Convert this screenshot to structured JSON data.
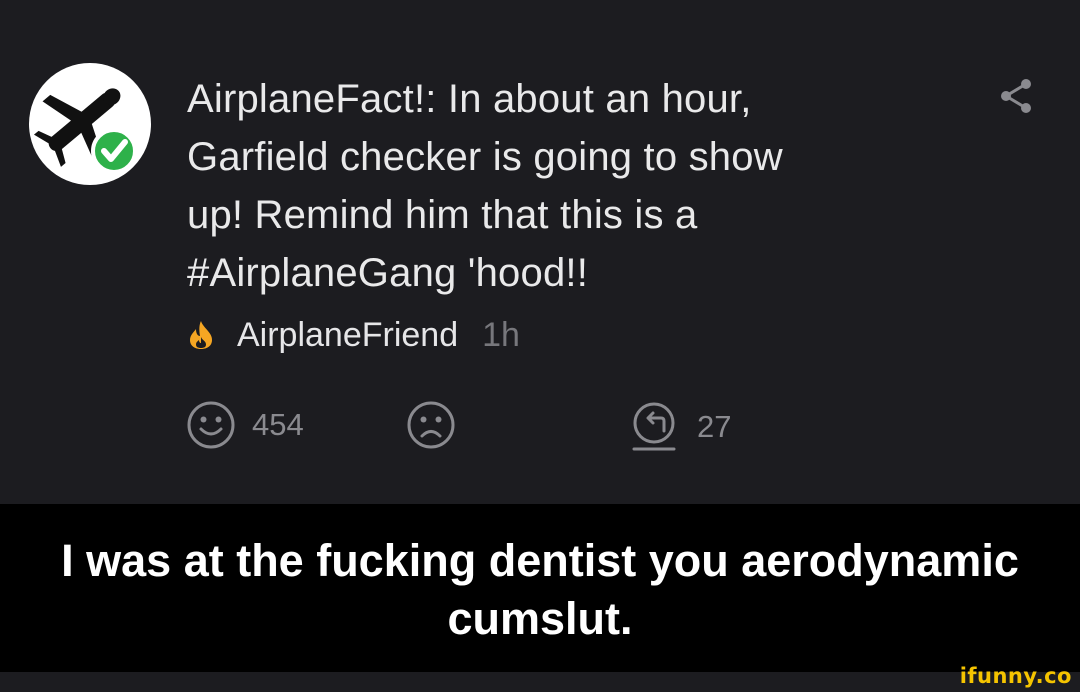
{
  "post": {
    "avatar_icon": "airplane-icon",
    "verified_icon": "checkmark-badge-icon",
    "username": "AirplaneFact!",
    "lines": [
      "AirplaneFact!: In about an hour,",
      "Garfield checker is going to show",
      "up! Remind him that this is a",
      "#AirplaneGang 'hood!!"
    ],
    "share_icon": "share-icon",
    "meta": {
      "flame_icon": "flame-icon",
      "author": "AirplaneFriend",
      "time": "1h"
    },
    "actions": {
      "smile_icon": "smile-icon",
      "smile_count": "454",
      "frown_icon": "frown-icon",
      "reply_icon": "reply-icon",
      "reply_count": "27"
    }
  },
  "caption": {
    "lines": [
      "I was at the fucking dentist you aerodynamic",
      "cumslut."
    ]
  },
  "watermark": "ifunny.co",
  "colors": {
    "background": "#1c1c20",
    "verified_green": "#2eb14a",
    "flame": "#f5a623",
    "watermark": "#f5c400"
  }
}
